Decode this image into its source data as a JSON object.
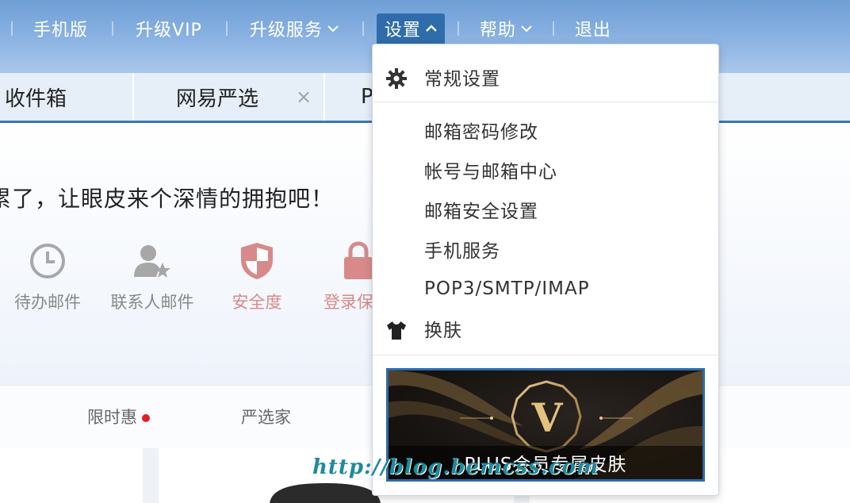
{
  "topnav": {
    "items": [
      {
        "label": "手机版"
      },
      {
        "label": "升级VIP"
      },
      {
        "label": "升级服务"
      },
      {
        "label": "设置"
      },
      {
        "label": "帮助"
      },
      {
        "label": "退出"
      }
    ]
  },
  "tabs": [
    {
      "label": "收件箱"
    },
    {
      "label": "网易严选",
      "close": "×"
    },
    {
      "label": "P"
    }
  ],
  "main": {
    "headline": "累了，让眼皮来个深情的拥抱吧！",
    "shortcuts": [
      {
        "label": "待办邮件",
        "icon": "clock-icon"
      },
      {
        "label": "联系人邮件",
        "icon": "contact-star-icon"
      },
      {
        "label": "安全度",
        "icon": "shield-icon"
      },
      {
        "label": "登录保",
        "icon": "lock-icon"
      }
    ]
  },
  "strip": {
    "items": [
      {
        "label": "限时惠"
      },
      {
        "label": "严选家"
      }
    ]
  },
  "settings_menu": {
    "general": "常规设置",
    "password": "邮箱密码修改",
    "account_center": "帐号与邮箱中心",
    "security": "邮箱安全设置",
    "mobile": "手机服务",
    "protocols": "POP3/SMTP/IMAP",
    "skin": "换肤",
    "banner_letter": "V",
    "banner_caption": "PLUS会员专属皮肤"
  },
  "watermark": "http://blog.bemcss.com",
  "colors": {
    "accent": "#2f6cab",
    "danger": "#d88a8a",
    "muted": "#888888"
  }
}
